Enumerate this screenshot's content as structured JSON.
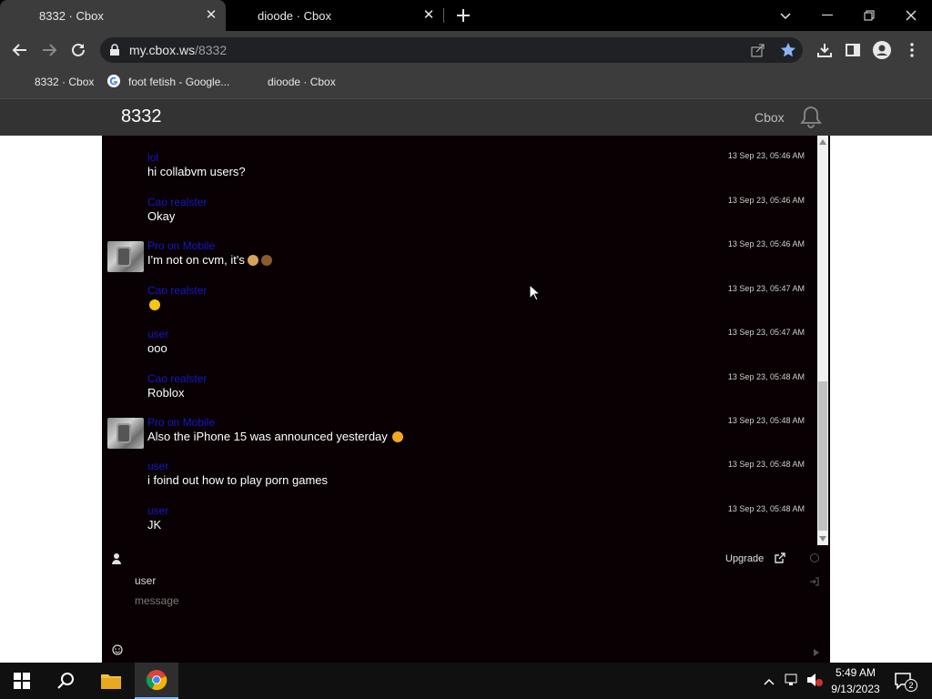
{
  "browser": {
    "tabs": [
      {
        "title": "8332 · Cbox",
        "active": true
      },
      {
        "title": "dioode · Cbox",
        "active": false
      }
    ],
    "url": {
      "host": "my.cbox.ws",
      "path": "/8332"
    },
    "bookmarks": [
      "8332 · Cbox",
      "foot fetish - Google...",
      "dioode · Cbox"
    ]
  },
  "site": {
    "title": "8332",
    "brand": "Cbox"
  },
  "messages": [
    {
      "user": "lol",
      "text": "hi collabvm users?",
      "time": "13 Sep 23, 05:46 AM",
      "avatar": false
    },
    {
      "user": "Cao realster",
      "text": "Okay",
      "time": "13 Sep 23, 05:46 AM",
      "avatar": false
    },
    {
      "user": "Pro on Mobile",
      "text": "I'm not on cvm, it's",
      "time": "13 Sep 23, 05:46 AM",
      "avatar": true,
      "emoji": [
        "dog",
        "poop"
      ]
    },
    {
      "user": "Cao realster",
      "text": "",
      "time": "13 Sep 23, 05:47 AM",
      "avatar": false,
      "emoji": [
        "smile"
      ]
    },
    {
      "user": "user",
      "text": "ooo",
      "time": "13 Sep 23, 05:47 AM",
      "avatar": false
    },
    {
      "user": "Cao realster",
      "text": "Roblox",
      "time": "13 Sep 23, 05:48 AM",
      "avatar": false
    },
    {
      "user": "Pro on Mobile",
      "text": "Also the iPhone 15 was announced yesterday",
      "time": "13 Sep 23, 05:48 AM",
      "avatar": true,
      "emoji": [
        "heart-eyes"
      ]
    },
    {
      "user": "user",
      "text": "i foind out how to play porn games",
      "time": "13 Sep 23, 05:48 AM",
      "avatar": false
    },
    {
      "user": "user",
      "text": "JK",
      "time": "13 Sep 23, 05:48 AM",
      "avatar": false
    }
  ],
  "composer": {
    "name_value": "user",
    "message_placeholder": "message",
    "upgrade_label": "Upgrade"
  },
  "taskbar": {
    "time": "5:49 AM",
    "date": "9/13/2023",
    "notifications": "2"
  },
  "colors": {
    "chat_bg": "#080002",
    "username": "#1717c9",
    "header_bg": "#333333"
  }
}
